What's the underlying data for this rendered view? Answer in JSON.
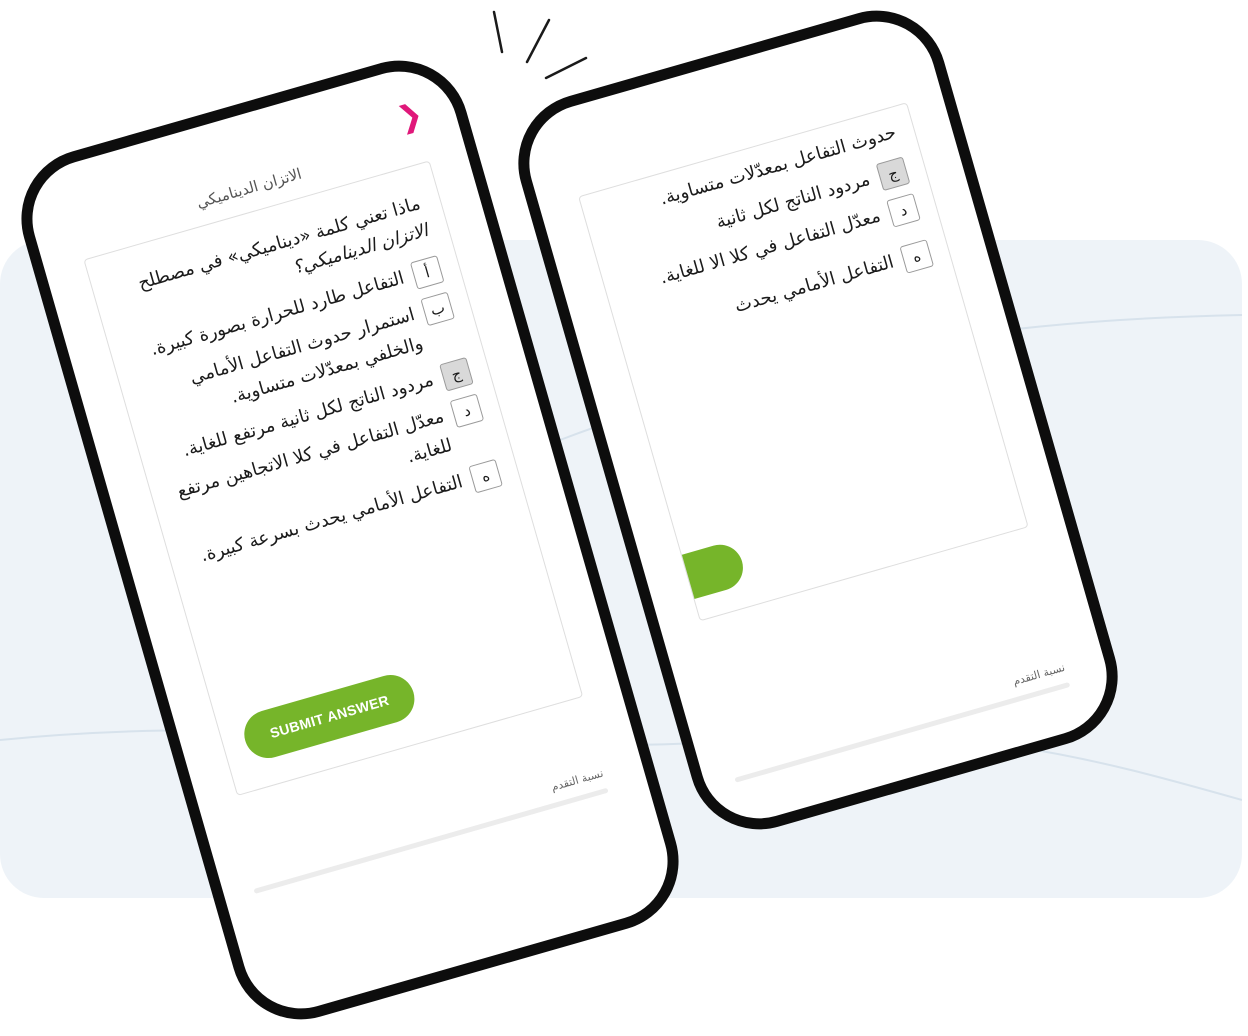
{
  "colors": {
    "accent_green": "#76b52a",
    "back_arrow": "#e0187a",
    "background_card": "#eef3f8"
  },
  "lesson": {
    "title": "الاتزان الديناميكي"
  },
  "question": {
    "text": "ماذا تعني كلمة «ديناميكي» في مصطلح",
    "term": "الاتزان الديناميكي؟"
  },
  "answers": [
    {
      "key": "أ",
      "text": "التفاعل طارد للحرارة بصورة كبيرة.",
      "selected": false
    },
    {
      "key": "ب",
      "text": "استمرار حدوث التفاعل الأمامي والخلفي بمعدّلات متساوية.",
      "selected": false
    },
    {
      "key": "ج",
      "text": "مردود الناتج لكل ثانية مرتفع للغاية.",
      "selected": true
    },
    {
      "key": "د",
      "text": "معدّل التفاعل في كلا الاتجاهين مرتفع للغاية.",
      "selected": false
    },
    {
      "key": "ه",
      "text": "التفاعل الأمامي يحدث بسرعة كبيرة.",
      "selected": false
    }
  ],
  "back_screen": {
    "answers": [
      {
        "key": "",
        "text": "حدوث التفاعل بمعدّلات متساوية."
      },
      {
        "key": "ج",
        "text": "مردود الناتج لكل ثانية"
      },
      {
        "key": "د",
        "text": "معدّل التفاعل في كلا الا للغاية."
      },
      {
        "key": "ه",
        "text": "التفاعل الأمامي يحدث"
      }
    ]
  },
  "submit": {
    "label": "SUBMIT ANSWER"
  },
  "progress": {
    "label": "نسبة التقدم",
    "value": 0
  },
  "icons": {
    "back": "chevron-icon",
    "burst": "burst-lines-icon"
  }
}
